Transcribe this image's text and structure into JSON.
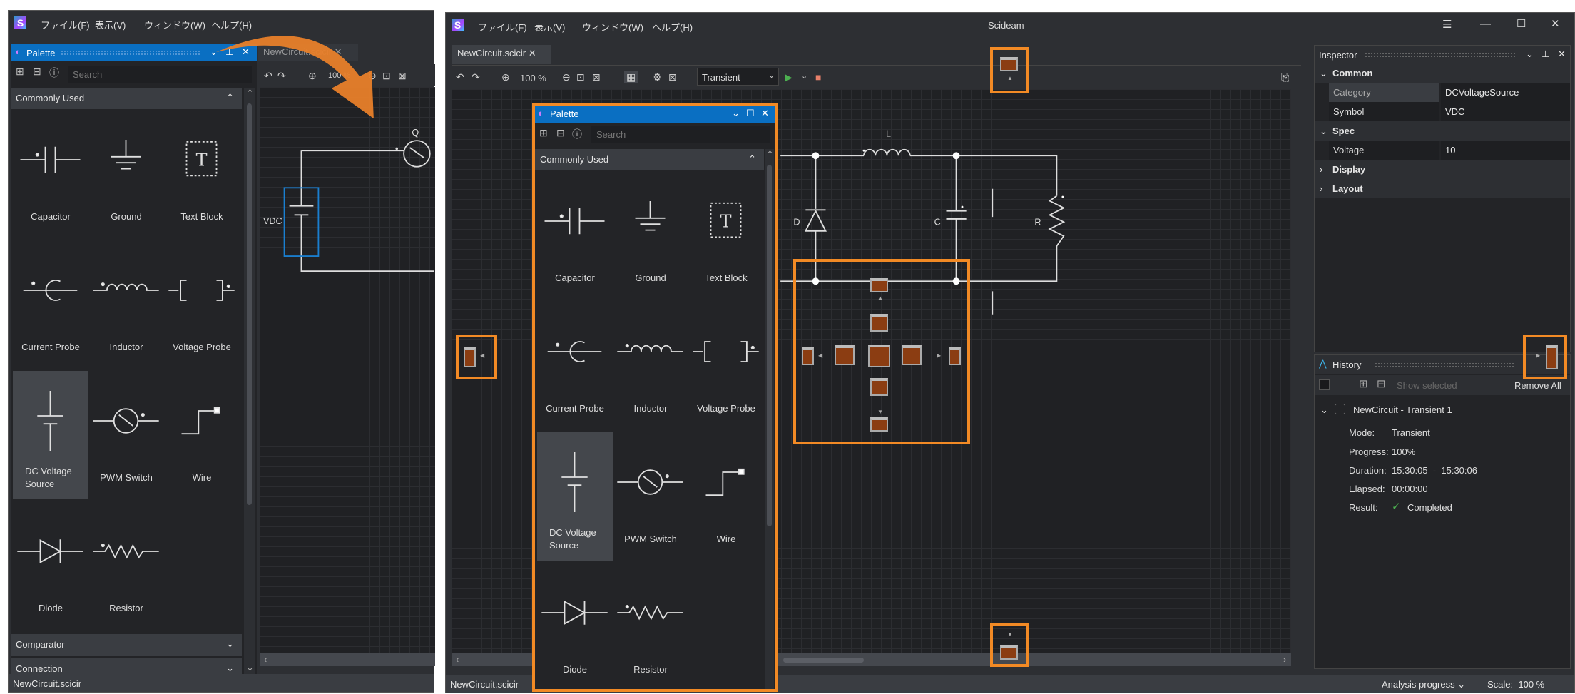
{
  "app": {
    "title": "Scideam",
    "menu": [
      "ファイル(F)",
      "表示(V)",
      "ウィンドウ(W)",
      "ヘルプ(H)"
    ]
  },
  "document_tab": "NewCircuit.scicir",
  "toolbar": {
    "zoom": "100 %",
    "mode": "Transient"
  },
  "palette": {
    "title": "Palette",
    "search_placeholder": "Search",
    "category_open": "Commonly Used",
    "categories_closed": [
      "Comparator",
      "Connection"
    ],
    "items": [
      {
        "label": "Capacitor",
        "icon": "capacitor"
      },
      {
        "label": "Ground",
        "icon": "ground"
      },
      {
        "label": "Text Block",
        "icon": "text-block"
      },
      {
        "label": "Current Probe",
        "icon": "current-probe"
      },
      {
        "label": "Inductor",
        "icon": "inductor"
      },
      {
        "label": "Voltage Probe",
        "icon": "voltage-probe"
      },
      {
        "label": "DC Voltage Source",
        "icon": "dc-voltage-source",
        "selected": true
      },
      {
        "label": "PWM Switch",
        "icon": "pwm-switch"
      },
      {
        "label": "Wire",
        "icon": "wire"
      },
      {
        "label": "Diode",
        "icon": "diode"
      },
      {
        "label": "Resistor",
        "icon": "resistor"
      }
    ]
  },
  "circuit_left": {
    "switch_label": "Q",
    "source_label": "VDC"
  },
  "circuit_right": {
    "inductor_label": "L",
    "diode_label": "D",
    "capacitor_label": "C",
    "resistor_label": "R"
  },
  "inspector": {
    "title": "Inspector",
    "rows": [
      {
        "type": "group",
        "label": "Common",
        "expanded": true
      },
      {
        "type": "prop",
        "label": "Category",
        "value": "DCVoltageSource"
      },
      {
        "type": "prop",
        "label": "Symbol",
        "value": "VDC"
      },
      {
        "type": "group",
        "label": "Spec",
        "expanded": true
      },
      {
        "type": "prop",
        "label": "Voltage",
        "value": "10"
      },
      {
        "type": "group",
        "label": "Display",
        "expanded": false
      },
      {
        "type": "group",
        "label": "Layout",
        "expanded": false
      }
    ]
  },
  "history": {
    "title": "History",
    "show_selected": "Show selected",
    "remove_all": "Remove All",
    "entry": {
      "name": "NewCircuit - Transient 1",
      "mode_label": "Mode:",
      "mode": "Transient",
      "progress_label": "Progress:",
      "progress": "100%",
      "duration_label": "Duration:",
      "duration": "15:30:05  -  15:30:06",
      "elapsed_label": "Elapsed:",
      "elapsed": "00:00:00",
      "result_label": "Result:",
      "result": "Completed"
    }
  },
  "status": {
    "file": "NewCircuit.scicir",
    "analysis": "Analysis progress",
    "scale": "Scale:  100 %"
  },
  "colors": {
    "accent_blue": "#0a6fc2",
    "highlight_orange": "#f28a25",
    "dock_preview": "#8b3d12",
    "success": "#4caf50"
  }
}
